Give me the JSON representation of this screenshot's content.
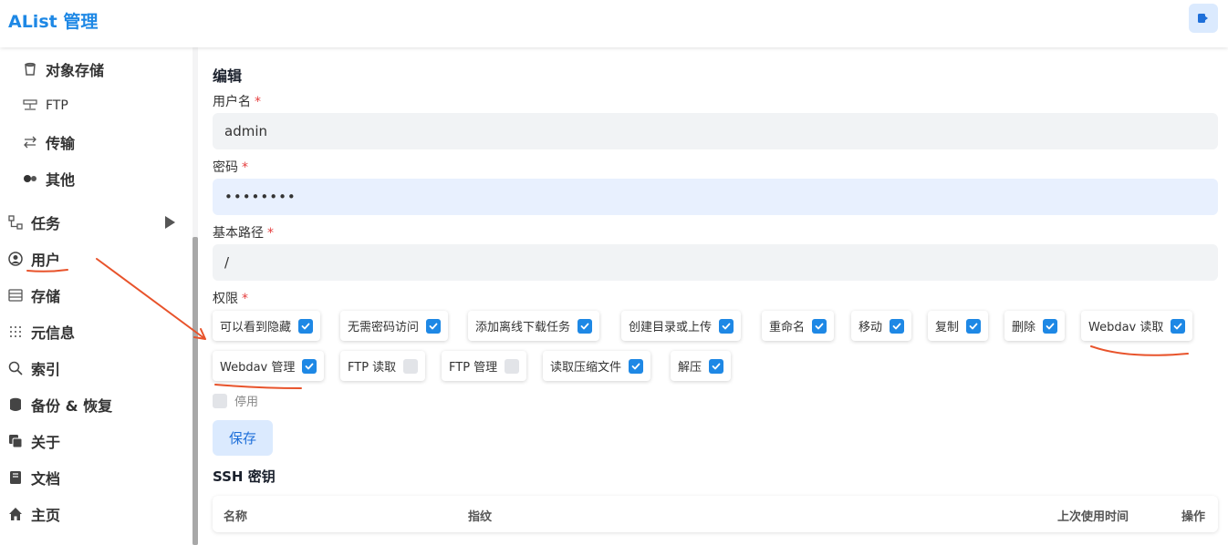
{
  "header": {
    "title": "AList 管理"
  },
  "sidebar": {
    "items": [
      {
        "label": "对象存储",
        "icon": "bucket-icon"
      },
      {
        "label": "FTP",
        "icon": "ftp-icon"
      },
      {
        "label": "传输",
        "icon": "transfer-icon"
      },
      {
        "label": "其他",
        "icon": "toggle-icon"
      },
      {
        "label": "任务",
        "icon": "tasks-icon"
      },
      {
        "label": "用户",
        "icon": "user-icon"
      },
      {
        "label": "存储",
        "icon": "storage-icon"
      },
      {
        "label": "元信息",
        "icon": "meta-icon"
      },
      {
        "label": "索引",
        "icon": "search-icon"
      },
      {
        "label": "备份 & 恢复",
        "icon": "database-icon"
      },
      {
        "label": "关于",
        "icon": "copy-icon"
      },
      {
        "label": "文档",
        "icon": "book-icon"
      },
      {
        "label": "主页",
        "icon": "home-icon"
      }
    ]
  },
  "form": {
    "title": "编辑",
    "username_label": "用户名",
    "username_value": "admin",
    "password_label": "密码",
    "password_value": "••••••••",
    "basepath_label": "基本路径",
    "basepath_value": "/",
    "permissions_label": "权限",
    "required_mark": "*",
    "permissions": [
      {
        "label": "可以看到隐藏",
        "checked": true
      },
      {
        "label": "无需密码访问",
        "checked": true
      },
      {
        "label": "添加离线下载任务",
        "checked": true
      },
      {
        "label": "创建目录或上传",
        "checked": true
      },
      {
        "label": "重命名",
        "checked": true
      },
      {
        "label": "移动",
        "checked": true
      },
      {
        "label": "复制",
        "checked": true
      },
      {
        "label": "删除",
        "checked": true
      },
      {
        "label": "Webdav 读取",
        "checked": true
      },
      {
        "label": "Webdav 管理",
        "checked": true
      },
      {
        "label": "FTP 读取",
        "checked": false
      },
      {
        "label": "FTP 管理",
        "checked": false
      },
      {
        "label": "读取压缩文件",
        "checked": true
      },
      {
        "label": "解压",
        "checked": true
      }
    ],
    "disable_label": "停用",
    "save_label": "保存"
  },
  "ssh": {
    "title": "SSH 密钥",
    "columns": [
      "名称",
      "指纹",
      "上次使用时间",
      "操作"
    ]
  },
  "colors": {
    "accent": "#1e88e5",
    "annotation": "#e8532b"
  }
}
